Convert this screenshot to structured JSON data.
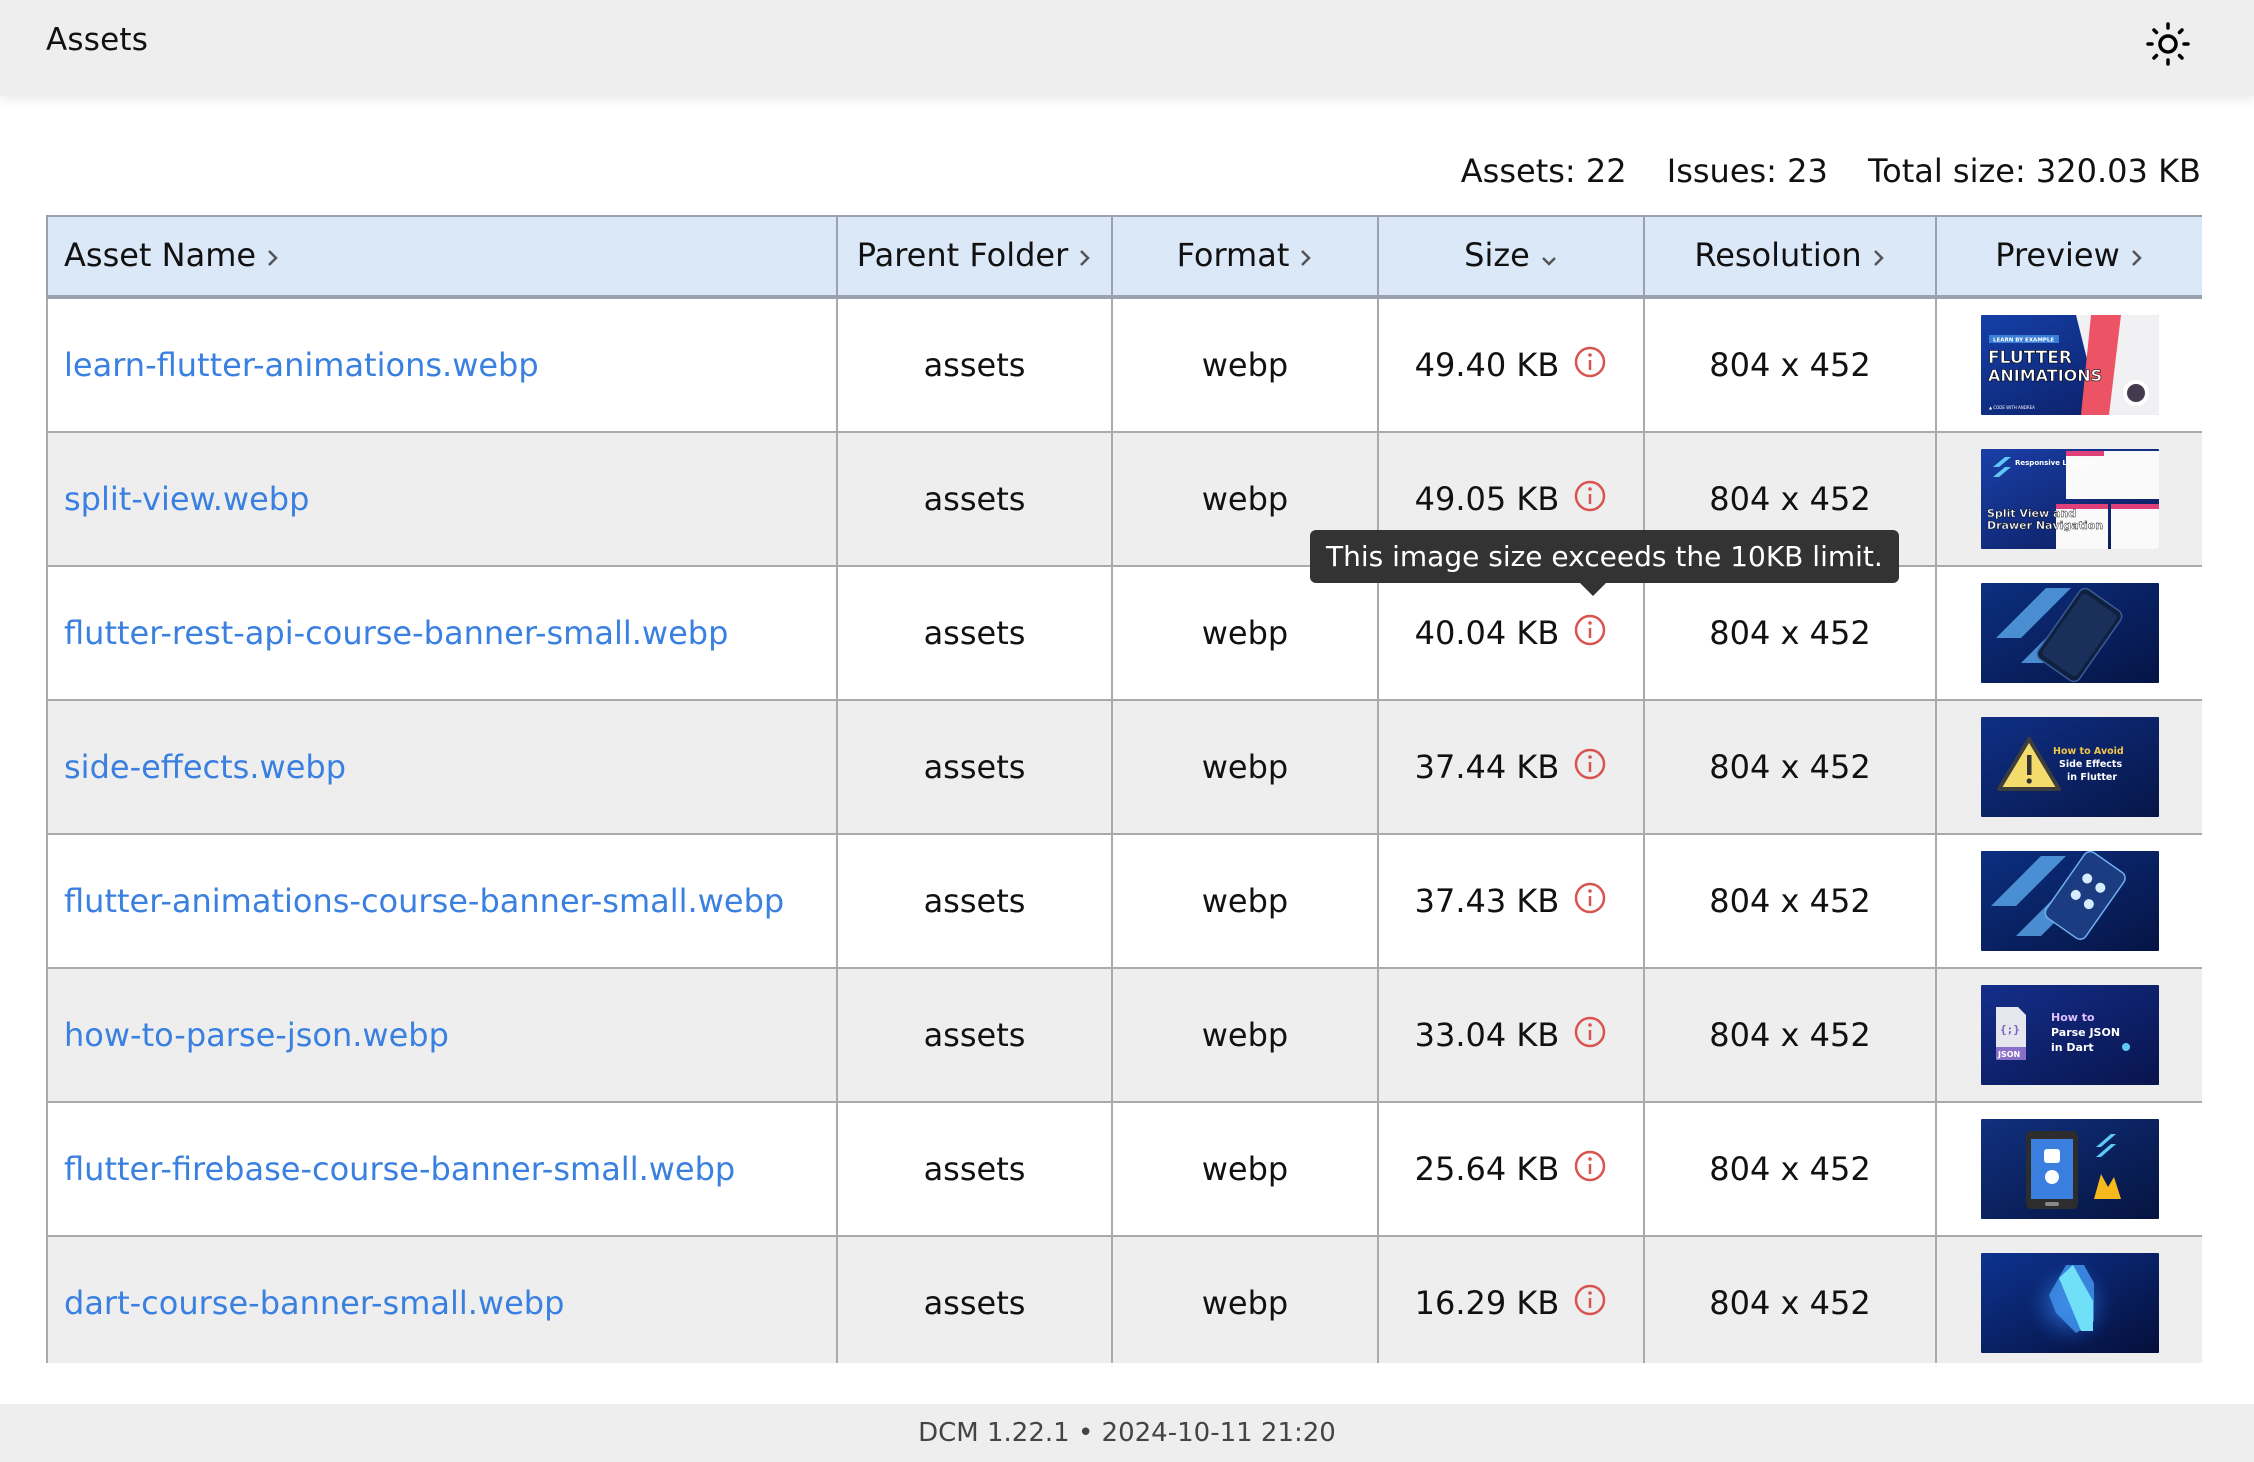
{
  "header": {
    "title": "Assets",
    "theme_toggle_icon": "sun-icon"
  },
  "summary": {
    "assets": "Assets: 22",
    "issues": "Issues: 23",
    "total_size": "Total size: 320.03 KB"
  },
  "table": {
    "columns": [
      {
        "label": "Asset Name",
        "sort_icon": "chevron-right-icon"
      },
      {
        "label": "Parent Folder",
        "sort_icon": "chevron-right-icon"
      },
      {
        "label": "Format",
        "sort_icon": "chevron-right-icon"
      },
      {
        "label": "Size",
        "sort_icon": "chevron-down-icon"
      },
      {
        "label": "Resolution",
        "sort_icon": "chevron-right-icon"
      },
      {
        "label": "Preview",
        "sort_icon": "chevron-right-icon"
      }
    ],
    "rows": [
      {
        "name": "learn-flutter-animations.webp",
        "folder": "assets",
        "format": "webp",
        "size": "49.40 KB",
        "resolution": "804 x 452",
        "preview": "Flutter Animations banner"
      },
      {
        "name": "split-view.webp",
        "folder": "assets",
        "format": "webp",
        "size": "49.05 KB",
        "resolution": "804 x 452",
        "preview": "Split View and Drawer Navigation banner"
      },
      {
        "name": "flutter-rest-api-course-banner-small.webp",
        "folder": "assets",
        "format": "webp",
        "size": "40.04 KB",
        "resolution": "804 x 452",
        "preview": "Phone app banner"
      },
      {
        "name": "side-effects.webp",
        "folder": "assets",
        "format": "webp",
        "size": "37.44 KB",
        "resolution": "804 x 452",
        "preview": "How to Avoid Side Effects in Flutter banner"
      },
      {
        "name": "flutter-animations-course-banner-small.webp",
        "folder": "assets",
        "format": "webp",
        "size": "37.43 KB",
        "resolution": "804 x 452",
        "preview": "Phone animations banner"
      },
      {
        "name": "how-to-parse-json.webp",
        "folder": "assets",
        "format": "webp",
        "size": "33.04 KB",
        "resolution": "804 x 452",
        "preview": "How to Parse JSON in Dart banner"
      },
      {
        "name": "flutter-firebase-course-banner-small.webp",
        "folder": "assets",
        "format": "webp",
        "size": "25.64 KB",
        "resolution": "804 x 452",
        "preview": "Flutter Firebase banner"
      },
      {
        "name": "dart-course-banner-small.webp",
        "folder": "assets",
        "format": "webp",
        "size": "16.29 KB",
        "resolution": "804 x 452",
        "preview": "Dart logo banner"
      }
    ]
  },
  "thumb_text": {
    "t1_tag": "LEARN BY EXAMPLE",
    "t1_line1": "FLUTTER",
    "t1_line2": "ANIMATIONS",
    "t2_tag": "Responsive Layouts",
    "t2_line1": "Split View and",
    "t2_line2": "Drawer Navigation",
    "t4_line1": "How to Avoid",
    "t4_line2": "Side Effects",
    "t4_line3": "in Flutter",
    "t6_line1": "How to",
    "t6_line2": "Parse JSON",
    "t6_line3": "in Dart",
    "t6_badge": "JSON"
  },
  "tooltip": {
    "text": "This image size exceeds the 10KB limit."
  },
  "colors": {
    "link": "#3a80e0",
    "header_bg": "#dbe8f8",
    "warning": "#d9534f",
    "tooltip_bg": "#333333"
  },
  "footer": {
    "text": "DCM 1.22.1 • 2024-10-11 21:20"
  }
}
